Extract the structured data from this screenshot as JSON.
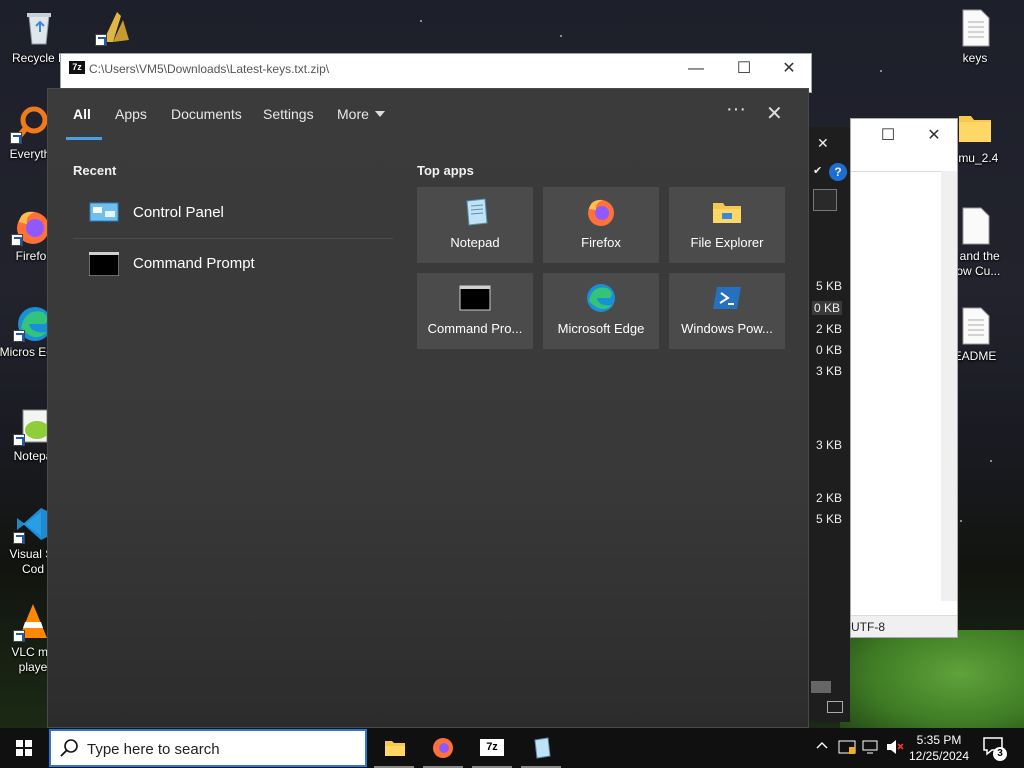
{
  "desktop": {
    "icons": [
      {
        "label": "Recycle B",
        "icon": "recycle-bin-icon"
      },
      {
        "label": "Everyth",
        "icon": "everything-search-icon"
      },
      {
        "label": "Firefo",
        "icon": "firefox-icon"
      },
      {
        "label": "Micros Edge",
        "icon": "edge-icon"
      },
      {
        "label": "Notepa",
        "icon": "notepad-plus-icon"
      },
      {
        "label": "Visual St Cod",
        "icon": "vscode-icon"
      },
      {
        "label": "VLC me playe",
        "icon": "vlc-icon"
      },
      {
        "label": "keys",
        "icon": "text-file-icon"
      },
      {
        "label": "emu_2.4",
        "icon": "folder-icon"
      },
      {
        "label": "y and the bow Cu...",
        "icon": "file-icon"
      },
      {
        "label": "EADME",
        "icon": "text-file-icon"
      }
    ]
  },
  "bg_window_7z": {
    "title": "C:\\Users\\VM5\\Downloads\\Latest-keys.txt.zip\\",
    "app_icon": "7z"
  },
  "bg_window_dark": {
    "sizes": [
      "5 KB",
      "0 KB",
      "2 KB",
      "0 KB",
      "3 KB",
      "3 KB",
      "2 KB",
      "5 KB"
    ]
  },
  "bg_window_notepad": {
    "status": "UTF-8"
  },
  "search_panel": {
    "tabs": [
      "All",
      "Apps",
      "Documents",
      "Settings",
      "More"
    ],
    "more_icon": "ellipsis-icon",
    "close_icon": "close-icon",
    "recent_title": "Recent",
    "recent_items": [
      {
        "label": "Control Panel",
        "icon": "control-panel-icon"
      },
      {
        "label": "Command Prompt",
        "icon": "command-prompt-icon"
      }
    ],
    "top_apps_title": "Top apps",
    "top_apps": [
      {
        "label": "Notepad",
        "icon": "notepad-icon"
      },
      {
        "label": "Firefox",
        "icon": "firefox-icon"
      },
      {
        "label": "File Explorer",
        "icon": "file-explorer-icon"
      },
      {
        "label": "Command Pro...",
        "icon": "command-prompt-icon"
      },
      {
        "label": "Microsoft Edge",
        "icon": "edge-icon"
      },
      {
        "label": "Windows Pow...",
        "icon": "powershell-icon"
      }
    ]
  },
  "taskbar": {
    "search_placeholder": "Type here to search",
    "pinned": [
      "file-explorer-icon",
      "firefox-icon",
      "7zip-icon",
      "notepad-icon"
    ],
    "clock_time": "5:35 PM",
    "clock_date": "12/25/2024",
    "notification_count": "3",
    "accent": "#2b79d0"
  }
}
